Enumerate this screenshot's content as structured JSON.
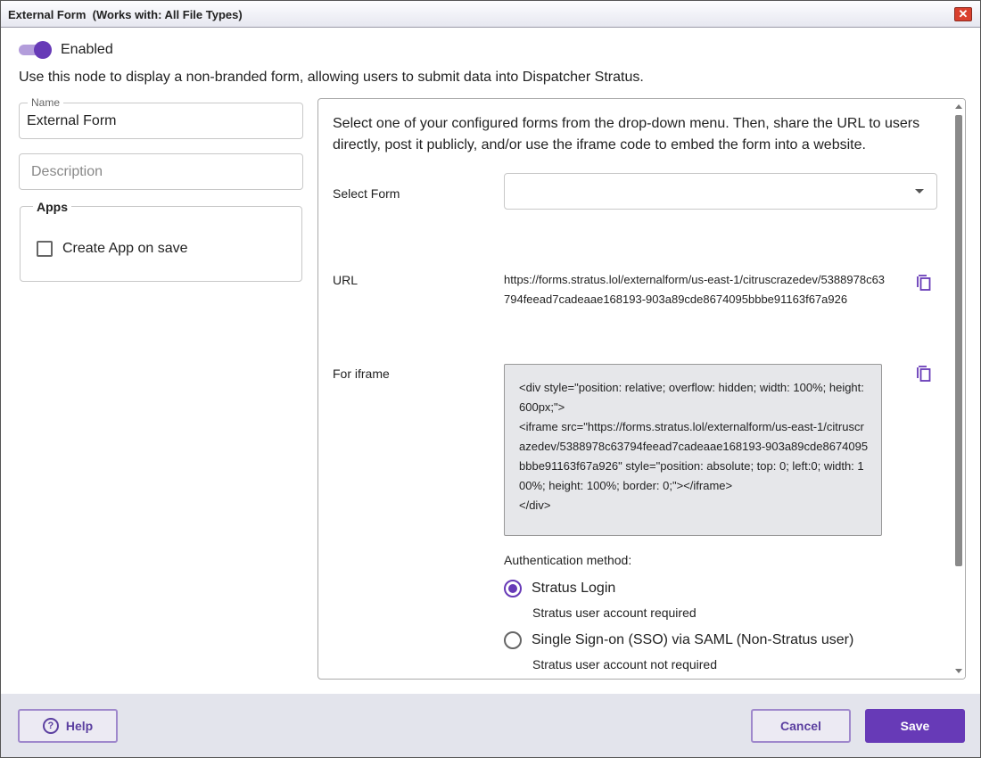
{
  "window": {
    "title": "External Form  (Works with: All File Types)",
    "close_glyph": "✕"
  },
  "enabled": {
    "label": "Enabled",
    "on": true,
    "accent": "#673ab7"
  },
  "description": "Use this node to display a non-branded form, allowing users to submit data into Dispatcher Stratus.",
  "name_field": {
    "label": "Name",
    "value": "External Form"
  },
  "description_field": {
    "placeholder": "Description"
  },
  "apps": {
    "legend": "Apps",
    "create_app_label": "Create App on save",
    "checked": false
  },
  "panel": {
    "intro": "Select one of your configured forms from the drop-down menu. Then, share the URL to users directly, post it publicly, and/or use the iframe code to embed the form into a website.",
    "select_form_label": "Select Form",
    "select_form_value": "",
    "url_label": "URL",
    "url": "https://forms.stratus.lol/externalform/us-east-1/citruscrazedev/5388978c63794feead7cadeaae168193-903a89cde8674095bbbe91163f67a926",
    "iframe_label": "For iframe",
    "iframe_line1": "<div style=\"position: relative; overflow: hidden; width: 100%; height: 600px;\">",
    "iframe_line2": "<iframe src=\"https://forms.stratus.lol/externalform/us-east-1/citruscrazedev/5388978c63794feead7cadeaae168193-903a89cde8674095bbbe91163f67a926\" style=\"position: absolute; top: 0; left:0; width: 100%; height: 100%; border: 0;\"></iframe>",
    "iframe_line3": "</div>",
    "auth_label": "Authentication method:",
    "auth_options": [
      {
        "label": "Stratus Login",
        "sub": "Stratus user account required",
        "selected": true
      },
      {
        "label": "Single Sign-on (SSO) via SAML (Non-Stratus user)",
        "sub": "Stratus user account not required",
        "selected": false
      }
    ]
  },
  "footer": {
    "help": "Help",
    "cancel": "Cancel",
    "save": "Save"
  }
}
